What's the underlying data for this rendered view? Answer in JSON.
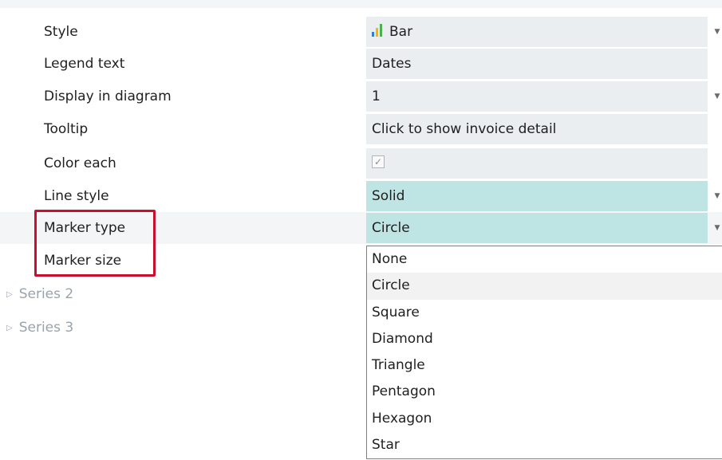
{
  "properties": [
    {
      "label": "Style",
      "value": "Bar",
      "icon": "bar-chart-icon",
      "dropdown": true
    },
    {
      "label": "Legend text",
      "value": "Dates",
      "dropdown": false
    },
    {
      "label": "Display in diagram",
      "value": "1",
      "dropdown": true
    },
    {
      "label": "Tooltip",
      "value": "Click to show invoice detail",
      "dropdown": false
    },
    {
      "label": "Color each",
      "checked": true,
      "dropdown": false
    },
    {
      "label": "Line style",
      "value": "Solid",
      "dropdown": true
    },
    {
      "label": "Marker type",
      "value": "Circle",
      "dropdown": true
    },
    {
      "label": "Marker size"
    }
  ],
  "series": [
    {
      "label": "Series 2"
    },
    {
      "label": "Series 3"
    }
  ],
  "marker_type_options": [
    "None",
    "Circle",
    "Square",
    "Diamond",
    "Triangle",
    "Pentagon",
    "Hexagon",
    "Star"
  ],
  "selected_option": "Circle",
  "colors": {
    "highlight_border": "#c8102e",
    "field_bg": "#eaeef0",
    "active_field_bg": "#bfe4e4",
    "series_text": "#9aa3ad"
  }
}
